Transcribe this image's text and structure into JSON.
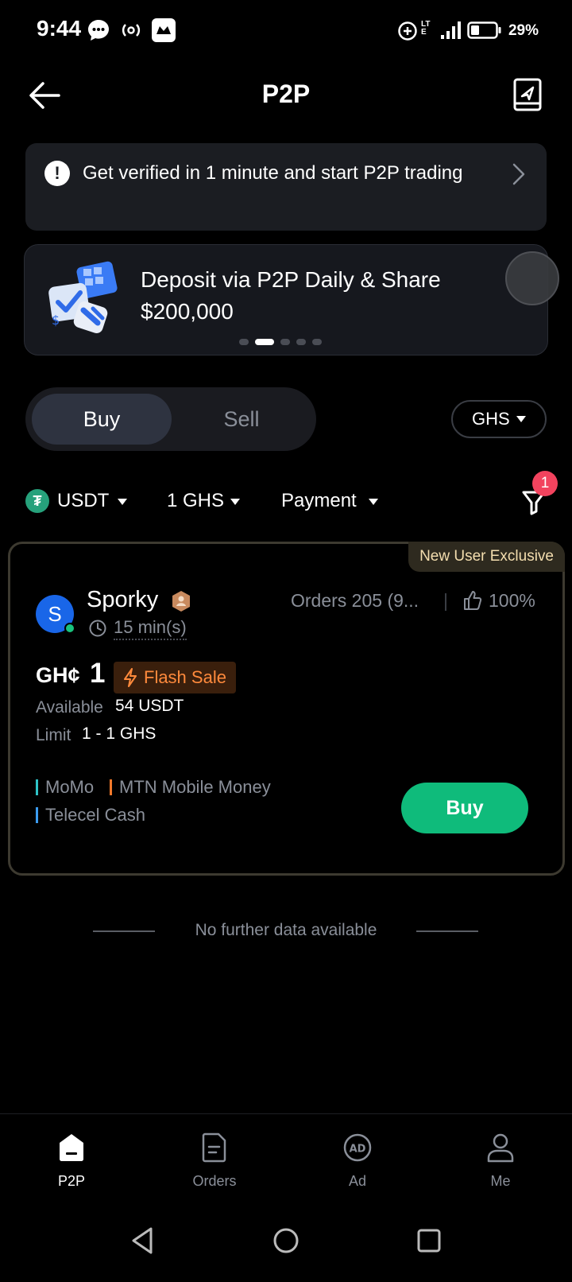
{
  "status_bar": {
    "time": "9:44",
    "network": "LTE",
    "battery": "29%"
  },
  "header": {
    "title": "P2P"
  },
  "verify_banner": {
    "text": "Get verified in 1 minute and start P2P trading"
  },
  "promo": {
    "text": "Deposit via P2P Daily & Share $200,000",
    "slide_count": 5,
    "active_slide": 2
  },
  "trade_toggle": {
    "buy_label": "Buy",
    "sell_label": "Sell",
    "selected": "Buy"
  },
  "fiat_select": {
    "value": "GHS"
  },
  "filters": {
    "crypto": "USDT",
    "amount": "1 GHS",
    "payment": "Payment",
    "badge_count": "1"
  },
  "offer": {
    "tag": "New User Exclusive",
    "avatar_letter": "S",
    "merchant": "Sporky",
    "response_time": "15 min(s)",
    "orders": "Orders 205 (9...",
    "completion_rate": "100%",
    "currency_symbol": "GH¢",
    "price": "1",
    "flash_label": "Flash Sale",
    "available_label": "Available",
    "available_value": "54 USDT",
    "limit_label": "Limit",
    "limit_value": "1 - 1 GHS",
    "payment_methods": [
      {
        "name": "MoMo",
        "color": "#2ec4c7"
      },
      {
        "name": "MTN Mobile Money",
        "color": "#f2792b"
      },
      {
        "name": "Telecel Cash",
        "color": "#3b9cf0"
      }
    ],
    "buy_label": "Buy"
  },
  "no_data_text": "No further data available",
  "bottom_nav": [
    {
      "label": "P2P",
      "icon": "home-icon",
      "active": true
    },
    {
      "label": "Orders",
      "icon": "document-icon",
      "active": false
    },
    {
      "label": "Ad",
      "icon": "ad-icon",
      "active": false
    },
    {
      "label": "Me",
      "icon": "person-icon",
      "active": false
    }
  ],
  "colors": {
    "accent_green": "#0fbb7b",
    "flash_orange": "#ff8a3c",
    "badge_red": "#f2435e",
    "tether_green": "#26a17b"
  }
}
